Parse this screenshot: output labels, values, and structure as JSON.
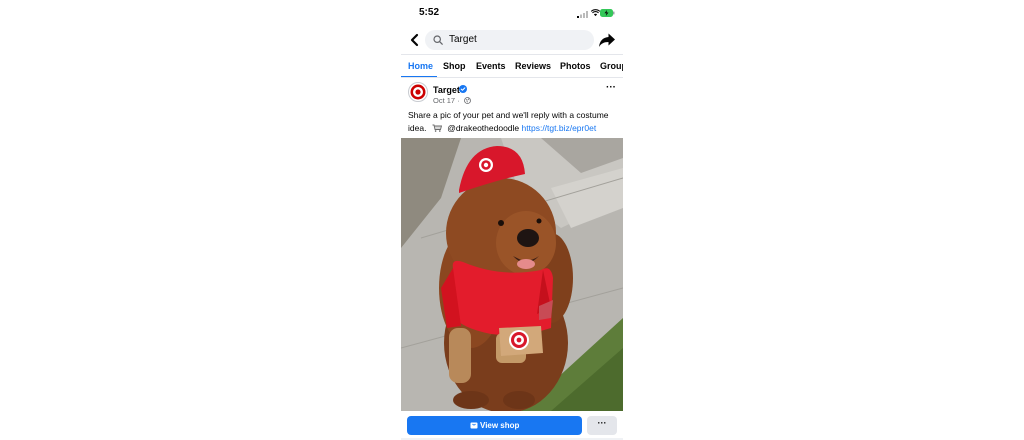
{
  "status_bar": {
    "time": "5:52",
    "signal_icon": "cellular-signal-icon",
    "wifi_icon": "wifi-icon",
    "battery_icon": "battery-charging-icon"
  },
  "top_bar": {
    "back_icon": "chevron-left-icon",
    "search_icon": "search-icon",
    "search_value": "Target",
    "share_icon": "share-arrow-icon"
  },
  "tabs": [
    {
      "label": "Home",
      "active": true
    },
    {
      "label": "Shop",
      "active": false
    },
    {
      "label": "Events",
      "active": false
    },
    {
      "label": "Reviews",
      "active": false
    },
    {
      "label": "Photos",
      "active": false
    },
    {
      "label": "Group",
      "active": false
    }
  ],
  "post": {
    "author": "Target",
    "verified": true,
    "date": "Oct 17 ·",
    "audience_icon": "globe-icon",
    "text_line1": "Share a pic of your pet and we'll reply with a costume",
    "text_line2_prefix": "idea.",
    "text_line2_mention": "@drakeothedoodle",
    "link": "https://tgt.biz/epr0et",
    "photo_icon": "dog-in-target-costume-photo"
  },
  "actions": {
    "view_shop_label": "View shop",
    "more_label": "···"
  },
  "colors": {
    "accent": "#1877f2",
    "brand_red": "#cc0000",
    "muted": "#65676b"
  }
}
